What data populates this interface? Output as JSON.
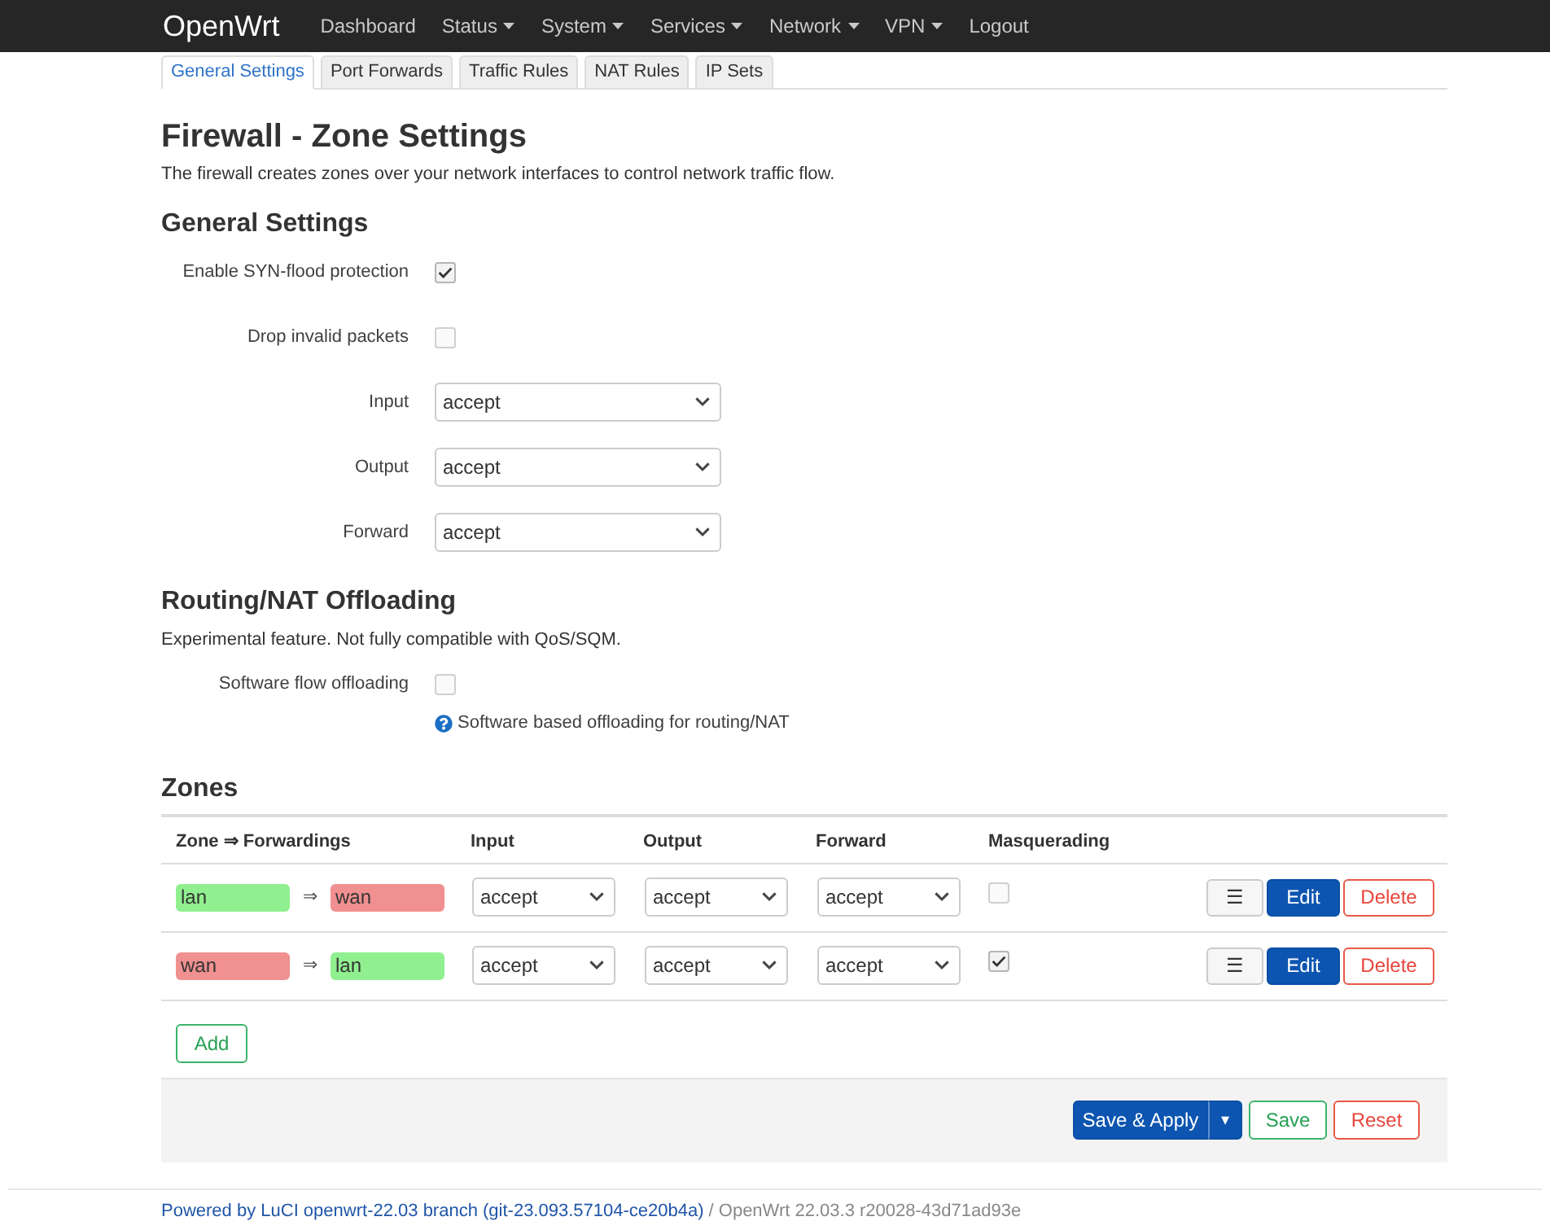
{
  "navbar": {
    "brand": "OpenWrt",
    "items": [
      {
        "label": "Dashboard",
        "dropdown": false
      },
      {
        "label": "Status",
        "dropdown": true
      },
      {
        "label": "System",
        "dropdown": true
      },
      {
        "label": "Services",
        "dropdown": true
      },
      {
        "label": "Network",
        "dropdown": true
      },
      {
        "label": "VPN",
        "dropdown": true
      },
      {
        "label": "Logout",
        "dropdown": false
      }
    ]
  },
  "tabs": [
    {
      "label": "General Settings",
      "selected": true
    },
    {
      "label": "Port Forwards",
      "selected": false
    },
    {
      "label": "Traffic Rules",
      "selected": false
    },
    {
      "label": "NAT Rules",
      "selected": false
    },
    {
      "label": "IP Sets",
      "selected": false
    }
  ],
  "page": {
    "title": "Firewall - Zone Settings",
    "description": "The firewall creates zones over your network interfaces to control network traffic flow."
  },
  "general_settings": {
    "heading": "General Settings",
    "fields": [
      {
        "kind": "checkbox",
        "label": "Enable SYN-flood protection",
        "checked": true
      },
      {
        "kind": "checkbox",
        "label": "Drop invalid packets",
        "checked": false
      },
      {
        "kind": "select",
        "label": "Input",
        "value": "accept"
      },
      {
        "kind": "select",
        "label": "Output",
        "value": "accept"
      },
      {
        "kind": "select",
        "label": "Forward",
        "value": "accept"
      }
    ]
  },
  "offloading": {
    "heading": "Routing/NAT Offloading",
    "description": "Experimental feature. Not fully compatible with QoS/SQM.",
    "fields": [
      {
        "kind": "checkbox",
        "label": "Software flow offloading",
        "checked": false,
        "help": "Software based offloading for routing/NAT"
      }
    ]
  },
  "zones": {
    "heading": "Zones",
    "columns": [
      "Zone ⇒ Forwardings",
      "Input",
      "Output",
      "Forward",
      "Masquerading"
    ],
    "rows": [
      {
        "zone": {
          "name": "lan",
          "color": "#90f090"
        },
        "arrow": "⇒",
        "forwardings": [
          {
            "name": "wan",
            "color": "#f09090"
          }
        ],
        "input": "accept",
        "output": "accept",
        "forward": "accept",
        "masquerading": false,
        "actions": [
          {
            "kind": "menu",
            "label": "☰"
          },
          {
            "kind": "edit",
            "label": "Edit"
          },
          {
            "kind": "delete",
            "label": "Delete"
          }
        ]
      },
      {
        "zone": {
          "name": "wan",
          "color": "#f09090"
        },
        "arrow": "⇒",
        "forwardings": [
          {
            "name": "lan",
            "color": "#90f090"
          }
        ],
        "input": "accept",
        "output": "accept",
        "forward": "accept",
        "masquerading": true,
        "actions": [
          {
            "kind": "menu",
            "label": "☰"
          },
          {
            "kind": "edit",
            "label": "Edit"
          },
          {
            "kind": "delete",
            "label": "Delete"
          }
        ]
      }
    ],
    "add_button": "Add"
  },
  "page_actions": {
    "save_apply": {
      "label": "Save & Apply",
      "menu": "▾"
    },
    "save": "Save",
    "reset": "Reset"
  },
  "footer": {
    "link": "Powered by LuCI openwrt-22.03 branch (git-23.093.57104-ce20b4a)",
    "version": "/ OpenWrt 22.03.3 r20028-43d71ad93e"
  }
}
